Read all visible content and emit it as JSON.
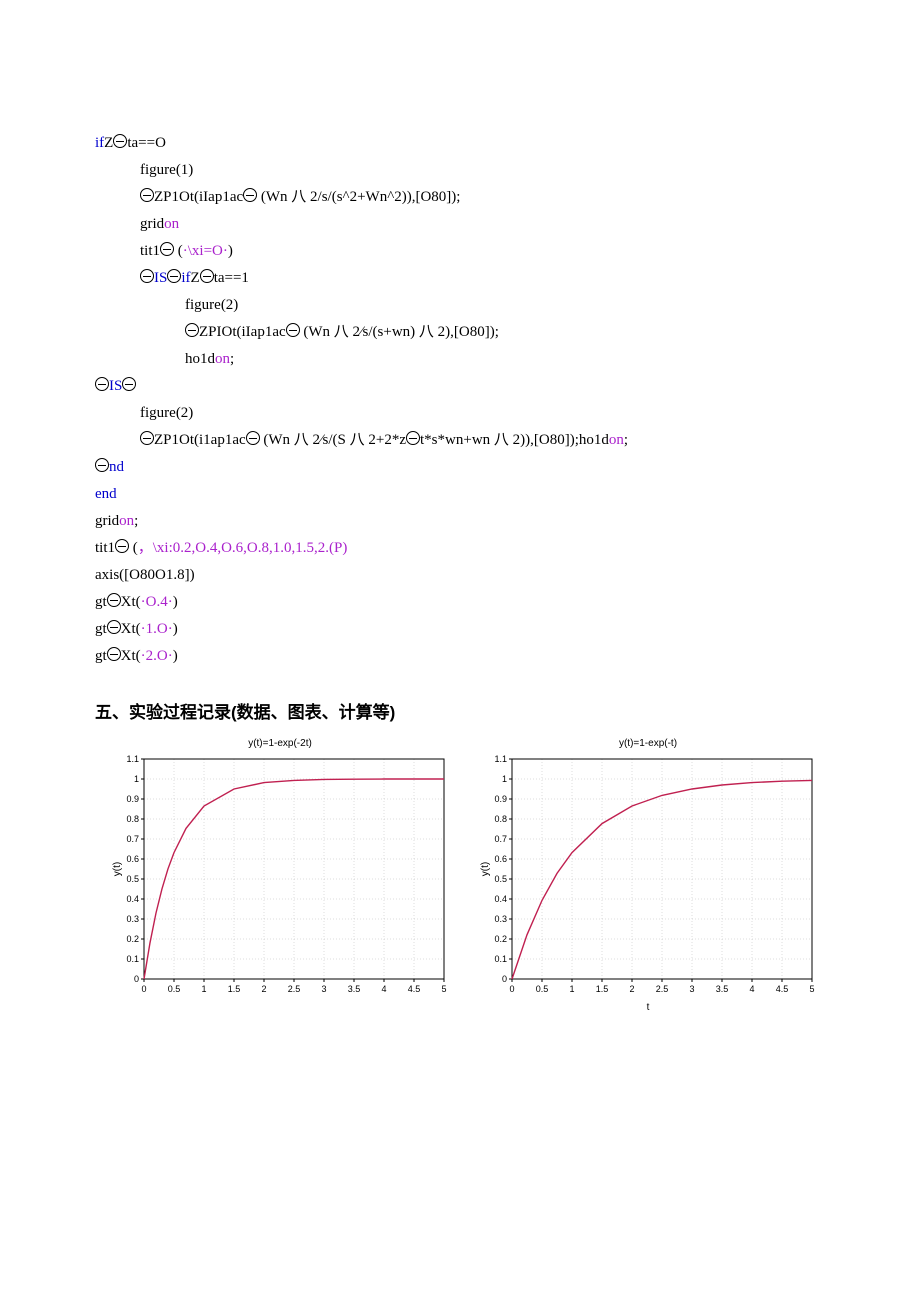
{
  "code": {
    "l1a": "if",
    "l1b": "Z",
    "l1c": "ta==O",
    "l2": "figure(1)",
    "l3a": "ZP1Ot(iIap1ac",
    "l3b": " (Wn 八 2/s/(s^2+Wn^2)),[O80]);",
    "l4a": "grid",
    "l4b": "on",
    "l5a": "tit1",
    "l5b": " (",
    "l5c": "·\\xi=O·",
    "l5d": ")",
    "l6a": "IS",
    "l6b": "if",
    "l6c": "Z",
    "l6d": "ta==1",
    "l7": "figure(2)",
    "l8a": "ZPIOt(iIap1ac",
    "l8b": " (Wn 八 2⁄s/(s+wn) 八 2),[O80]);",
    "l9a": "ho1d",
    "l9b": "on",
    "l9c": ";",
    "l10a": "IS",
    "l11": "figure(2)",
    "l12a": "ZP1Ot(i1ap1ac",
    "l12b": " (Wn 八 2⁄s/(S 八 2+2*z",
    "l12c": "t*s*wn+wn 八 2)),[O80]);ho1d",
    "l12d": "on",
    "l12e": ";",
    "l13a": "nd",
    "l14": "end",
    "l15a": "grid",
    "l15b": "on",
    "l15c": ";",
    "l16a": "tit1",
    "l16b": " (",
    "l16c": "，\\xi:0.2,O.4,O.6,O.8,1.0,1.5,2.(P)",
    "l17": "axis([O80O1.8])",
    "l18a": "gt",
    "l18b": "Xt(",
    "l18c": "·O.4·",
    "l18d": ")",
    "l19a": "gt",
    "l19b": "Xt(",
    "l19c": "·1.O·",
    "l19d": ")",
    "l20a": "gt",
    "l20b": "Xt(",
    "l20c": "·2.O·",
    "l20d": ")"
  },
  "section_header": "五、实验过程记录(数据、图表、计算等)",
  "chart_data": [
    {
      "type": "line",
      "title": "y(t)=1-exp(-2t)",
      "xlabel": "",
      "ylabel": "y(t)",
      "xlim": [
        0,
        5
      ],
      "ylim": [
        0,
        1.1
      ],
      "xticks": [
        0,
        0.5,
        1,
        1.5,
        2,
        2.5,
        3,
        3.5,
        4,
        4.5,
        5
      ],
      "yticks": [
        0,
        0.1,
        0.2,
        0.3,
        0.4,
        0.5,
        0.6,
        0.7,
        0.8,
        0.9,
        1,
        1.1
      ],
      "x": [
        0,
        0.1,
        0.2,
        0.3,
        0.4,
        0.5,
        0.7,
        1.0,
        1.5,
        2.0,
        2.5,
        3.0,
        3.5,
        4.0,
        4.5,
        5.0
      ],
      "y": [
        0,
        0.181,
        0.33,
        0.451,
        0.551,
        0.632,
        0.753,
        0.865,
        0.95,
        0.982,
        0.993,
        0.998,
        0.999,
        1.0,
        1.0,
        1.0
      ]
    },
    {
      "type": "line",
      "title": "y(t)=1-exp(-t)",
      "xlabel": "t",
      "ylabel": "y(t)",
      "xlim": [
        0,
        5
      ],
      "ylim": [
        0,
        1.1
      ],
      "xticks": [
        0,
        0.5,
        1,
        1.5,
        2,
        2.5,
        3,
        3.5,
        4,
        4.5,
        5
      ],
      "yticks": [
        0,
        0.1,
        0.2,
        0.3,
        0.4,
        0.5,
        0.6,
        0.7,
        0.8,
        0.9,
        1,
        1.1
      ],
      "x": [
        0,
        0.25,
        0.5,
        0.75,
        1.0,
        1.5,
        2.0,
        2.5,
        3.0,
        3.5,
        4.0,
        4.5,
        5.0
      ],
      "y": [
        0,
        0.221,
        0.393,
        0.528,
        0.632,
        0.777,
        0.865,
        0.918,
        0.95,
        0.97,
        0.982,
        0.989,
        0.993
      ]
    }
  ]
}
